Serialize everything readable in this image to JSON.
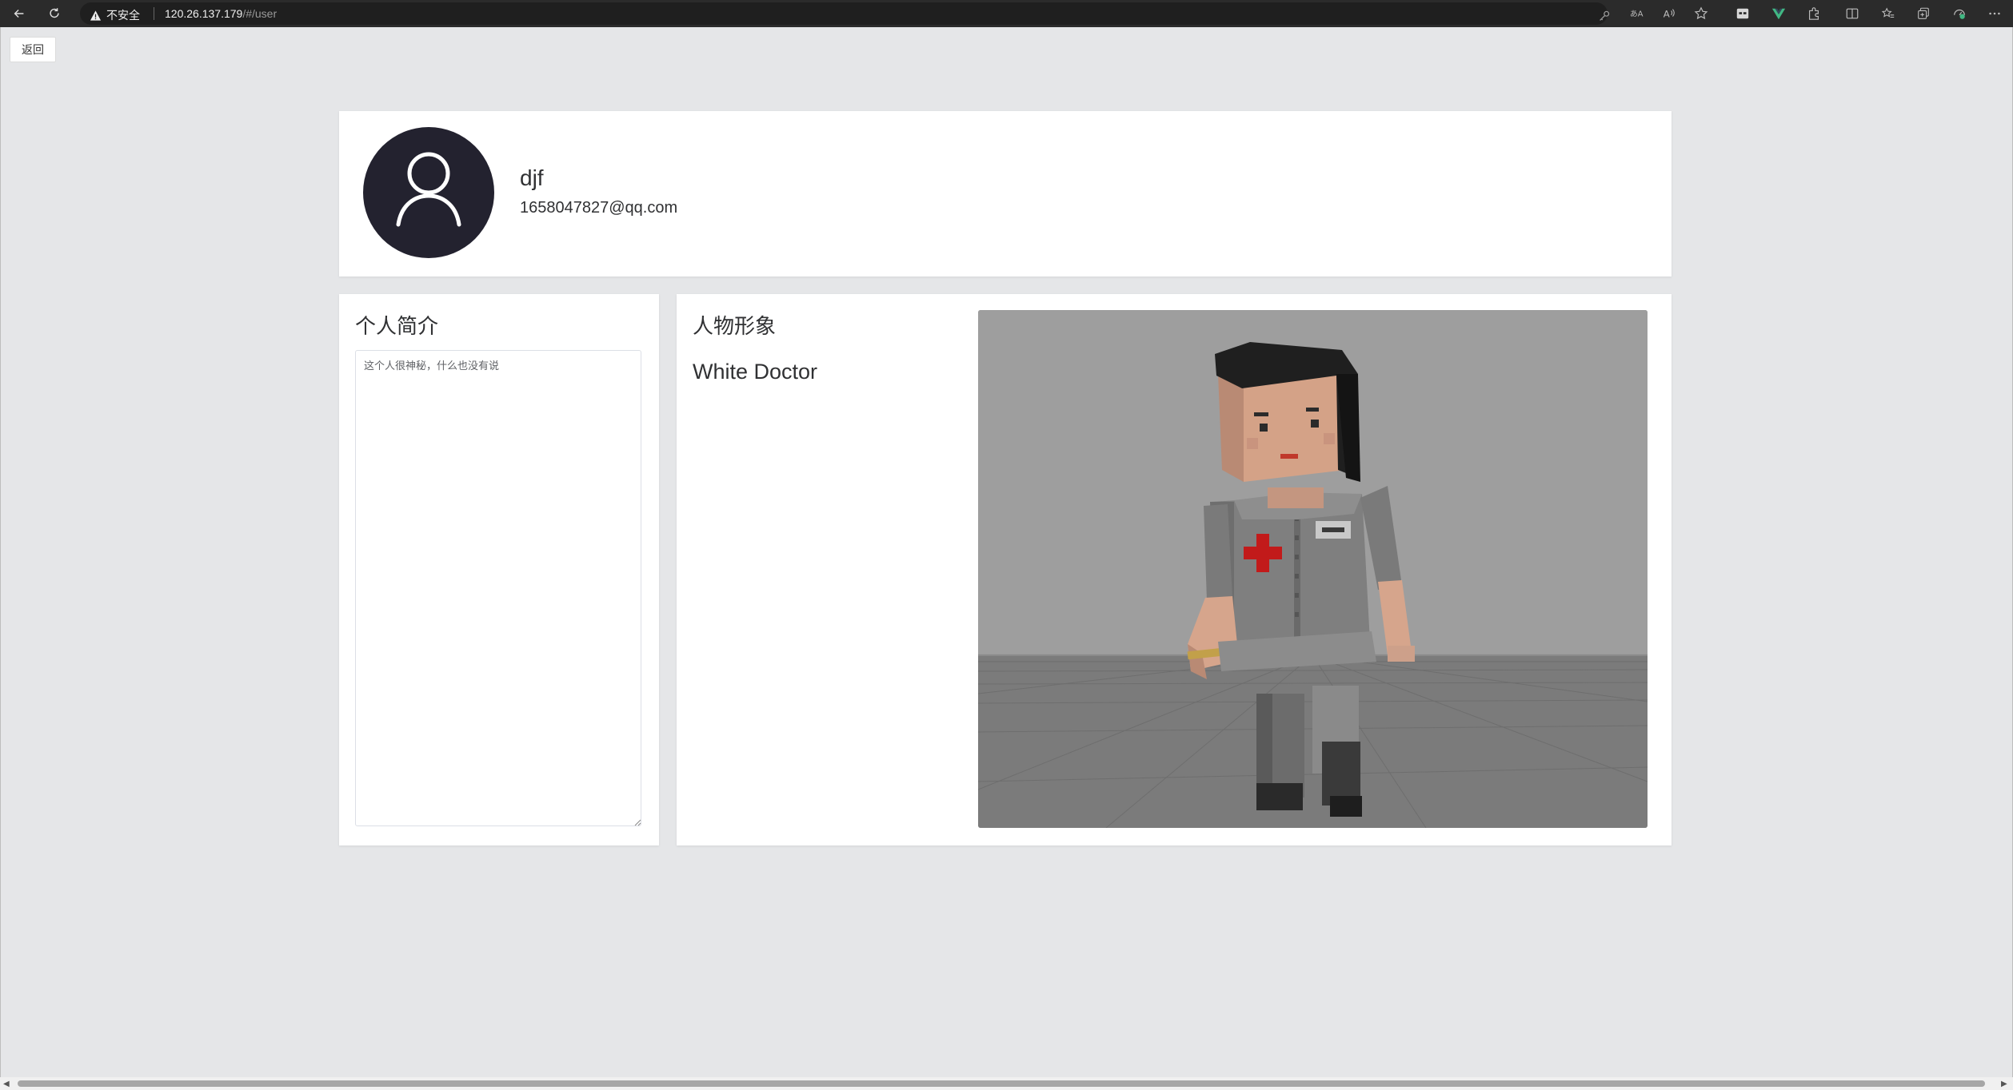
{
  "browser": {
    "security_label": "不安全",
    "url_host": "120.26.137.179",
    "url_path": "/#/user",
    "toolbar_icons": [
      "back-icon",
      "reload-icon",
      "key-icon",
      "translate-icon",
      "read-aloud-icon",
      "favorite-star-icon",
      "extension-icon",
      "vue-devtools-icon",
      "extensions-puzzle-icon",
      "split-screen-icon",
      "favorites-icon",
      "collections-icon",
      "performance-icon",
      "more-icon"
    ]
  },
  "page": {
    "back_label": "返回"
  },
  "profile": {
    "username": "djf",
    "email": "1658047827@qq.com"
  },
  "intro": {
    "title": "个人简介",
    "placeholder": "这个人很神秘，什么也没有说"
  },
  "character": {
    "title": "人物形象",
    "name": "White Doctor"
  },
  "colors": {
    "avatar_bg": "#23222f",
    "page_bg": "#e5e6e8",
    "card_bg": "#ffffff",
    "vue_green": "#41b883"
  }
}
